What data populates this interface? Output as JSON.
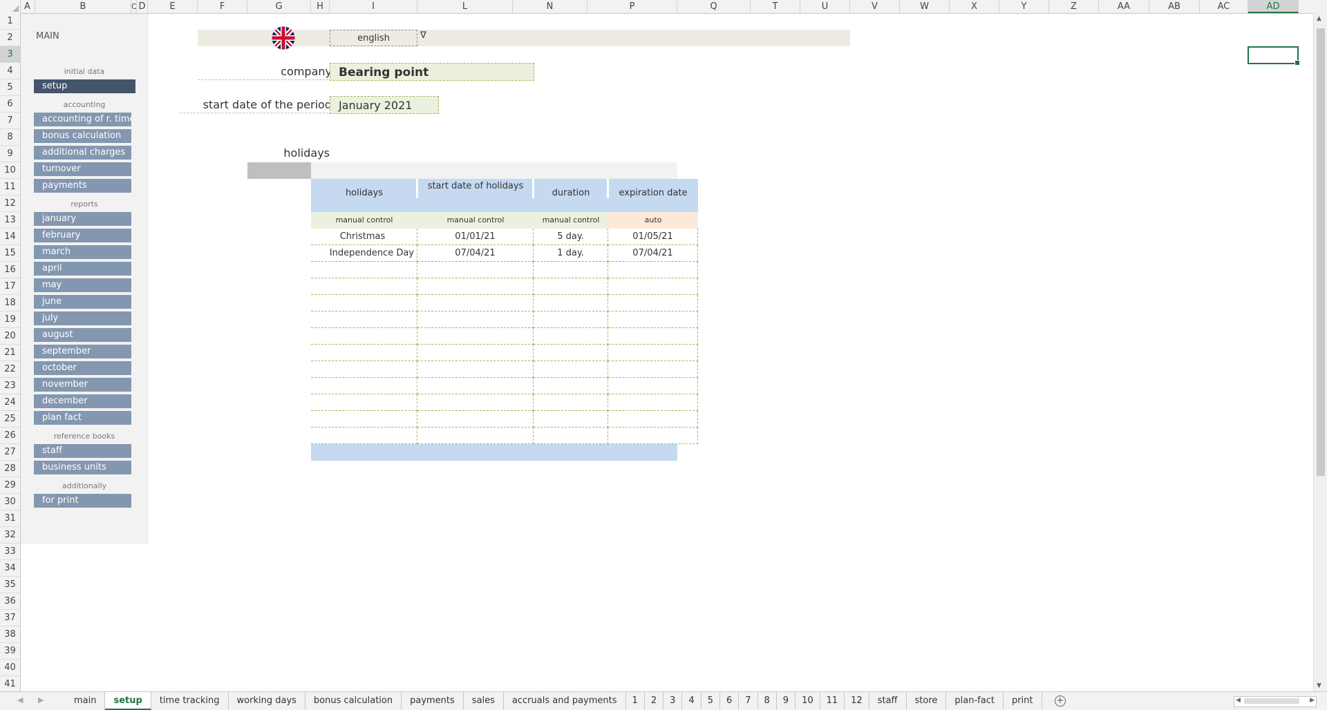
{
  "columns": [
    "A",
    "B",
    "C",
    "D",
    "E",
    "F",
    "G",
    "H",
    "I",
    "L",
    "N",
    "P",
    "Q",
    "T",
    "U",
    "V",
    "W",
    "X",
    "Y",
    "Z",
    "AA",
    "AB",
    "AC",
    "AD"
  ],
  "selected_column": "AD",
  "rows": [
    "1",
    "2",
    "3",
    "4",
    "5",
    "6",
    "7",
    "8",
    "9",
    "10",
    "11",
    "12",
    "13",
    "14",
    "15",
    "16",
    "17",
    "18",
    "19",
    "20",
    "21",
    "22",
    "23",
    "24",
    "25",
    "26",
    "27",
    "28",
    "29",
    "30",
    "31",
    "32",
    "33",
    "34",
    "35",
    "36",
    "37",
    "38",
    "39",
    "40",
    "41"
  ],
  "selected_row": "3",
  "sidebar": {
    "title": "MAIN",
    "sections": {
      "initial": "initial data",
      "accounting": "accounting",
      "reports": "reports",
      "reference": "reference books",
      "additionally": "additionally"
    },
    "items": {
      "setup": "setup",
      "accounting_time": "accounting of r. time",
      "bonus": "bonus calculation",
      "additional": "additional charges",
      "turnover": "turnover",
      "payments": "payments",
      "january": "january",
      "february": "february",
      "march": "march",
      "april": "april",
      "may": "may",
      "june": "june",
      "july": "july",
      "august": "august",
      "september": "september",
      "october": "october",
      "november": "november",
      "december": "december",
      "plan_fact": "plan fact",
      "staff": "staff",
      "business_units": "business units",
      "for_print": "for print"
    }
  },
  "language": {
    "value": "english",
    "dropdown": "∇",
    "flag_icon": "uk-flag-icon"
  },
  "company": {
    "label": "company",
    "value": "Bearing point"
  },
  "period": {
    "label": "start date of the period",
    "value": "January 2021"
  },
  "holidays": {
    "label": "holidays",
    "headers": [
      "holidays",
      "start date of holidays",
      "duration",
      "expiration date"
    ],
    "controls": [
      "manual control",
      "manual control",
      "manual control",
      "auto"
    ],
    "rows": [
      [
        "Christmas",
        "01/01/21",
        "5 day.",
        "01/05/21"
      ],
      [
        "Independence Day",
        "07/04/21",
        "1 day.",
        "07/04/21"
      ]
    ]
  },
  "tabs": [
    "main",
    "setup",
    "time tracking",
    "working days",
    "bonus calculation",
    "payments",
    "sales",
    "accruals and payments",
    "1",
    "2",
    "3",
    "4",
    "5",
    "6",
    "7",
    "8",
    "9",
    "10",
    "11",
    "12",
    "staff",
    "store",
    "plan-fact",
    "print"
  ],
  "active_tab": "setup",
  "colors": {
    "accent": "#217346",
    "nav_button": "#8497b0",
    "nav_active": "#44546a",
    "header_blue": "#c5d9f1"
  }
}
